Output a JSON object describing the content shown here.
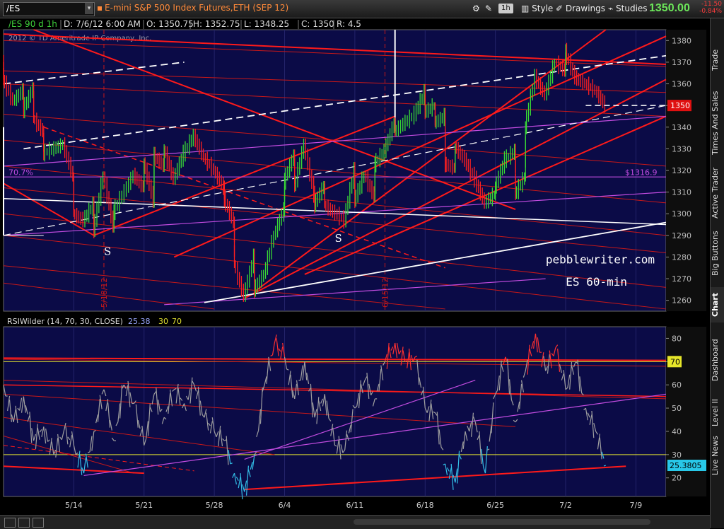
{
  "toolbar": {
    "symbol": "/ES",
    "title": "E-mini S&P 500 Index Futures,ETH (SEP 12)",
    "timeframe": "1h",
    "style_label": "Style",
    "drawings_label": "Drawings",
    "studies_label": "Studies",
    "last_price": "1350.00",
    "change": "-11.50",
    "change_pct": "-0.84%"
  },
  "side_tabs": [
    "Trade",
    "Times And Sales",
    "Active Trader",
    "Big Buttons",
    "Chart",
    "Dashboard",
    "Level II",
    "Live News"
  ],
  "colors": {
    "plot_bg": "#0b0b47",
    "frame": "#6a6a6a",
    "red": "#ff1a1a",
    "dark_red": "#c81818",
    "magenta": "#c24ce0",
    "white": "#ffffff",
    "candle_up": "#39d935",
    "candle_down": "#ff2020",
    "rsi_line": "#a0a0a0",
    "rsi_over": "#ff3030",
    "rsi_under": "#33c0e8",
    "yellow": "#e0e030"
  },
  "chart_data": [
    {
      "type": "candlestick",
      "header": {
        "symbol": "/ES 90 d 1h",
        "date": "D: 7/6/12 6:00 AM",
        "open": "O: 1350.75",
        "high": "H: 1352.75",
        "low": "L: 1348.25",
        "close": "C: 1350",
        "range": "R: 4.5"
      },
      "copyright": "2012 © TD Ameritrade IP Company, Inc.",
      "ylim": [
        1255,
        1385
      ],
      "y_ticks": [
        1260,
        1270,
        1280,
        1290,
        1300,
        1310,
        1320,
        1330,
        1340,
        1350,
        1360,
        1370,
        1380
      ],
      "current_price_label": "1350",
      "current_price": 1350,
      "fib_label": "70.7%",
      "fib_level": 1316.9,
      "fib_price_label": "$1316.9",
      "annotations": [
        "S",
        "S"
      ],
      "watermark": [
        "pebblewriter.com",
        "ES 60-min"
      ],
      "vertical_date_labels": [
        "5/18/12",
        "6/15/12"
      ],
      "price_path": [
        [
          "5/7",
          1370
        ],
        [
          "5/7",
          1362
        ],
        [
          "5/8",
          1352
        ],
        [
          "5/9",
          1357
        ],
        [
          "5/9",
          1348
        ],
        [
          "5/10",
          1358
        ],
        [
          "5/10",
          1344
        ],
        [
          "5/11",
          1338
        ],
        [
          "5/11",
          1328
        ],
        [
          "5/13",
          1332
        ],
        [
          "5/14",
          1317
        ],
        [
          "5/14",
          1300
        ],
        [
          "5/15",
          1297
        ],
        [
          "5/16",
          1304
        ],
        [
          "5/16",
          1292
        ],
        [
          "5/17",
          1318
        ],
        [
          "5/18",
          1294
        ],
        [
          "5/18",
          1301
        ],
        [
          "5/20",
          1318
        ],
        [
          "5/21",
          1312
        ],
        [
          "5/21",
          1324
        ],
        [
          "5/22",
          1306
        ],
        [
          "5/22",
          1327
        ],
        [
          "5/23",
          1322
        ],
        [
          "5/23",
          1330
        ],
        [
          "5/24",
          1316
        ],
        [
          "5/25",
          1328
        ],
        [
          "5/26",
          1336
        ],
        [
          "5/27",
          1326
        ],
        [
          "5/28",
          1320
        ],
        [
          "5/29",
          1312
        ],
        [
          "5/29",
          1307
        ],
        [
          "5/30",
          1296
        ],
        [
          "5/30",
          1277
        ],
        [
          "5/31",
          1262
        ],
        [
          "6/1",
          1280
        ],
        [
          "6/1",
          1265
        ],
        [
          "6/2",
          1272
        ],
        [
          "6/3",
          1290
        ],
        [
          "6/4",
          1302
        ],
        [
          "6/4",
          1315
        ],
        [
          "6/5",
          1327
        ],
        [
          "6/5",
          1312
        ],
        [
          "6/6",
          1332
        ],
        [
          "6/7",
          1309
        ],
        [
          "6/7",
          1304
        ],
        [
          "6/8",
          1313
        ],
        [
          "6/8",
          1304
        ],
        [
          "6/10",
          1297
        ],
        [
          "6/11",
          1320
        ],
        [
          "6/11",
          1306
        ],
        [
          "6/12",
          1318
        ],
        [
          "6/13",
          1308
        ],
        [
          "6/13",
          1323
        ],
        [
          "6/14",
          1329
        ],
        [
          "6/15",
          1342
        ],
        [
          "6/15",
          1338
        ],
        [
          "6/17",
          1346
        ],
        [
          "6/18",
          1356
        ],
        [
          "6/18",
          1347
        ],
        [
          "6/19",
          1350
        ],
        [
          "6/19",
          1342
        ],
        [
          "6/20",
          1345
        ],
        [
          "6/20",
          1323
        ],
        [
          "6/21",
          1321
        ],
        [
          "6/21",
          1331
        ],
        [
          "6/22",
          1325
        ],
        [
          "6/23",
          1316
        ],
        [
          "6/24",
          1305
        ],
        [
          "6/25",
          1309
        ],
        [
          "6/25",
          1312
        ],
        [
          "6/26",
          1325
        ],
        [
          "6/27",
          1329
        ],
        [
          "6/27",
          1309
        ],
        [
          "6/28",
          1317
        ],
        [
          "6/28",
          1340
        ],
        [
          "6/29",
          1363
        ],
        [
          "6/30",
          1355
        ],
        [
          "7/1",
          1370
        ],
        [
          "7/2",
          1366
        ],
        [
          "7/2",
          1375
        ],
        [
          "7/3",
          1363
        ],
        [
          "7/4",
          1360
        ],
        [
          "7/5",
          1357
        ],
        [
          "7/6",
          1350
        ]
      ]
    },
    {
      "type": "line",
      "title": "RSIWilder (14, 70, 30, CLOSE)",
      "value_label": "25.38",
      "level_labels": [
        "30",
        "70"
      ],
      "ylim": [
        12,
        85
      ],
      "y_ticks": [
        20,
        30,
        40,
        50,
        60,
        70,
        80
      ],
      "levels": [
        70,
        30
      ],
      "current_value": "25.3805",
      "x_ticks": [
        "5/14",
        "5/21",
        "5/28",
        "6/4",
        "6/11",
        "6/18",
        "6/25",
        "7/2",
        "7/9"
      ],
      "rsi_path": [
        [
          "5/7",
          60
        ],
        [
          "5/8",
          44
        ],
        [
          "5/9",
          55
        ],
        [
          "5/10",
          36
        ],
        [
          "5/11",
          42
        ],
        [
          "5/12",
          30
        ],
        [
          "5/13",
          40
        ],
        [
          "5/14",
          34
        ],
        [
          "5/15",
          22
        ],
        [
          "5/16",
          40
        ],
        [
          "5/17",
          58
        ],
        [
          "5/18",
          36
        ],
        [
          "5/19",
          60
        ],
        [
          "5/20",
          52
        ],
        [
          "5/21",
          34
        ],
        [
          "5/22",
          56
        ],
        [
          "5/23",
          46
        ],
        [
          "5/24",
          58
        ],
        [
          "5/25",
          52
        ],
        [
          "5/26",
          60
        ],
        [
          "5/27",
          46
        ],
        [
          "5/28",
          40
        ],
        [
          "5/29",
          36
        ],
        [
          "5/30",
          22
        ],
        [
          "5/31",
          14
        ],
        [
          "6/1",
          30
        ],
        [
          "6/2",
          60
        ],
        [
          "6/3",
          78
        ],
        [
          "6/4",
          72
        ],
        [
          "6/5",
          54
        ],
        [
          "6/6",
          70
        ],
        [
          "6/7",
          46
        ],
        [
          "6/8",
          56
        ],
        [
          "6/9",
          34
        ],
        [
          "6/10",
          32
        ],
        [
          "6/11",
          50
        ],
        [
          "6/12",
          62
        ],
        [
          "6/13",
          54
        ],
        [
          "6/14",
          70
        ],
        [
          "6/15",
          78
        ],
        [
          "6/16",
          70
        ],
        [
          "6/17",
          72
        ],
        [
          "6/18",
          50
        ],
        [
          "6/19",
          48
        ],
        [
          "6/20",
          26
        ],
        [
          "6/21",
          18
        ],
        [
          "6/22",
          40
        ],
        [
          "6/23",
          44
        ],
        [
          "6/24",
          22
        ],
        [
          "6/25",
          56
        ],
        [
          "6/26",
          72
        ],
        [
          "6/27",
          44
        ],
        [
          "6/28",
          66
        ],
        [
          "6/29",
          82
        ],
        [
          "6/30",
          66
        ],
        [
          "7/1",
          76
        ],
        [
          "7/2",
          58
        ],
        [
          "7/3",
          70
        ],
        [
          "7/4",
          50
        ],
        [
          "7/5",
          40
        ],
        [
          "7/6",
          25.38
        ]
      ]
    }
  ]
}
